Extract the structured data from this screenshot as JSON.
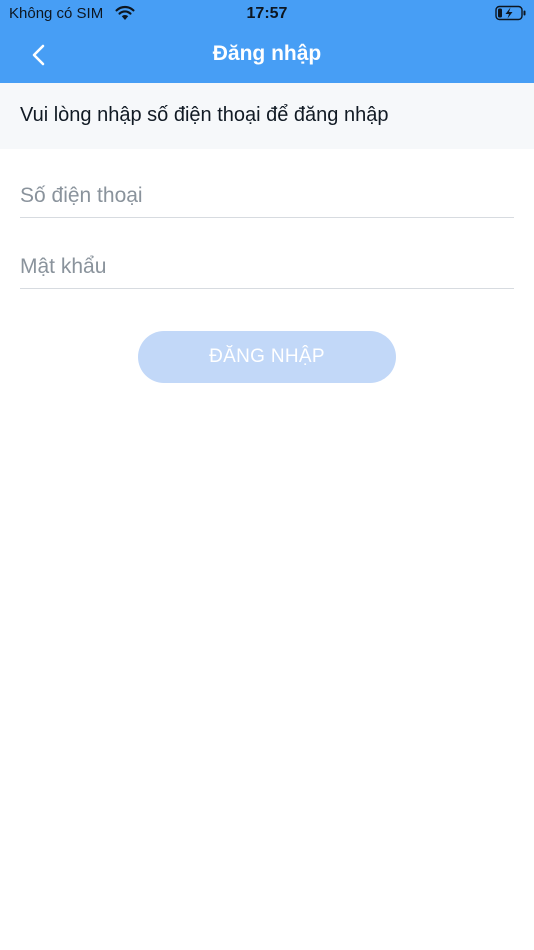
{
  "status_bar": {
    "carrier": "Không có SIM",
    "time": "17:57",
    "wifi_icon": "wifi-icon",
    "battery_icon": "battery-charging-icon"
  },
  "nav": {
    "title": "Đăng nhập",
    "back_icon": "chevron-left-icon",
    "background_color": "#479ef5"
  },
  "instruction": {
    "text": "Vui lòng nhập số điện thoại để đăng nhập"
  },
  "form": {
    "phone": {
      "value": "",
      "placeholder": "Số điện thoại"
    },
    "password": {
      "value": "",
      "placeholder": "Mật khẩu"
    },
    "submit_label": "ĐĂNG NHẬP",
    "submit_color": "#c2d8f8"
  }
}
